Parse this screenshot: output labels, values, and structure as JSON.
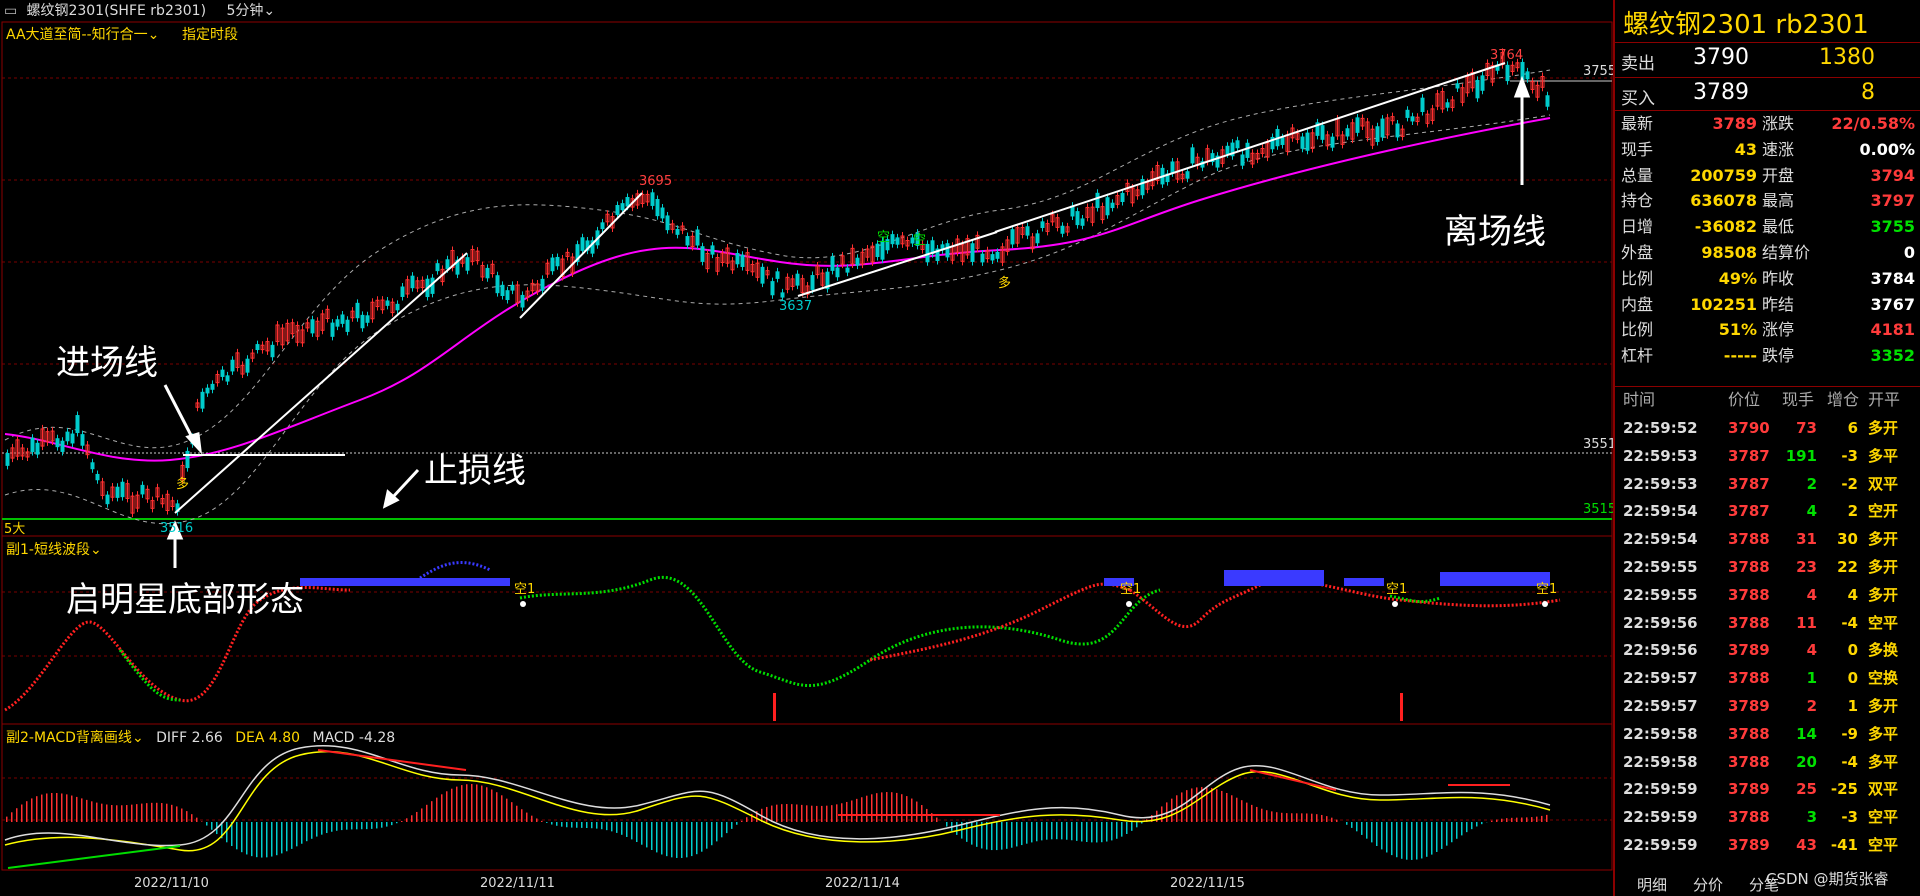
{
  "titlebar": {
    "instrument": "螺纹钢2301(SHFE rb2301)",
    "period": "5分钟"
  },
  "main": {
    "indicator_label": "AA大道至简--知行合一",
    "indicator_option": "指定时段",
    "price_tags": {
      "top": "3755",
      "mid": "3551",
      "bottom": "3515"
    },
    "peak_labels": {
      "p1": "3695",
      "p2": "3764",
      "t1": "3637",
      "t2": "3516"
    },
    "volume_tag": "5大",
    "signals": {
      "kong": "空",
      "duo": "多"
    }
  },
  "annotations": {
    "entry": "进场线",
    "stop": "止损线",
    "exit": "离场线",
    "pattern": "启明星底部形态"
  },
  "sub1": {
    "label": "副1-短线波段",
    "tag": "空1"
  },
  "sub2": {
    "label": "副2-MACD背离画线",
    "diff": "DIFF 2.66",
    "dea": "DEA 4.80",
    "macd": "MACD -4.28"
  },
  "xaxis": [
    "2022/11/10",
    "2022/11/11",
    "2022/11/14",
    "2022/11/15"
  ],
  "watermark": "CSDN @期货张睿",
  "panel": {
    "symbol": "螺纹钢2301  rb2301",
    "ask": {
      "label": "卖出",
      "price": "3790",
      "vol": "1380"
    },
    "bid": {
      "label": "买入",
      "price": "3789",
      "vol": "8"
    },
    "stats": [
      {
        "k": "最新",
        "v": "3789",
        "c": "red",
        "k2": "涨跌",
        "v2": "22/0.58%",
        "c2": "red"
      },
      {
        "k": "现手",
        "v": "43",
        "c": "yel",
        "k2": "速涨",
        "v2": "0.00%",
        "c2": "wht"
      },
      {
        "k": "总量",
        "v": "200759",
        "c": "yel",
        "k2": "开盘",
        "v2": "3794",
        "c2": "red"
      },
      {
        "k": "持仓",
        "v": "636078",
        "c": "yel",
        "k2": "最高",
        "v2": "3797",
        "c2": "red"
      },
      {
        "k": "日增",
        "v": "-36082",
        "c": "yel",
        "k2": "最低",
        "v2": "3755",
        "c2": "grn"
      },
      {
        "k": "外盘",
        "v": "98508",
        "c": "yel",
        "k2": "结算价",
        "v2": "0",
        "c2": "wht"
      },
      {
        "k": "比例",
        "v": "49%",
        "c": "yel",
        "k2": "昨收",
        "v2": "3784",
        "c2": "wht"
      },
      {
        "k": "内盘",
        "v": "102251",
        "c": "yel",
        "k2": "昨结",
        "v2": "3767",
        "c2": "wht"
      },
      {
        "k": "比例",
        "v": "51%",
        "c": "yel",
        "k2": "涨停",
        "v2": "4181",
        "c2": "red"
      },
      {
        "k": "杠杆",
        "v": "-----",
        "c": "yel",
        "k2": "跌停",
        "v2": "3352",
        "c2": "grn"
      }
    ],
    "table_headers": [
      "时间",
      "价位",
      "现手",
      "增仓",
      "开平"
    ],
    "trades": [
      {
        "t": "22:59:52",
        "p": "3790",
        "pc": "red",
        "n": "73",
        "nc": "red",
        "d": "6",
        "o": "多开"
      },
      {
        "t": "22:59:53",
        "p": "3787",
        "pc": "red",
        "n": "191",
        "nc": "grn",
        "d": "-3",
        "o": "多平"
      },
      {
        "t": "22:59:53",
        "p": "3787",
        "pc": "red",
        "n": "2",
        "nc": "grn",
        "d": "-2",
        "o": "双平"
      },
      {
        "t": "22:59:54",
        "p": "3787",
        "pc": "red",
        "n": "4",
        "nc": "grn",
        "d": "2",
        "o": "空开"
      },
      {
        "t": "22:59:54",
        "p": "3788",
        "pc": "red",
        "n": "31",
        "nc": "red",
        "d": "30",
        "o": "多开"
      },
      {
        "t": "22:59:55",
        "p": "3788",
        "pc": "red",
        "n": "23",
        "nc": "red",
        "d": "22",
        "o": "多开"
      },
      {
        "t": "22:59:55",
        "p": "3788",
        "pc": "red",
        "n": "4",
        "nc": "red",
        "d": "4",
        "o": "多开"
      },
      {
        "t": "22:59:56",
        "p": "3788",
        "pc": "red",
        "n": "11",
        "nc": "red",
        "d": "-4",
        "o": "空平"
      },
      {
        "t": "22:59:56",
        "p": "3789",
        "pc": "red",
        "n": "4",
        "nc": "red",
        "d": "0",
        "o": "多换"
      },
      {
        "t": "22:59:57",
        "p": "3788",
        "pc": "red",
        "n": "1",
        "nc": "grn",
        "d": "0",
        "o": "空换"
      },
      {
        "t": "22:59:57",
        "p": "3789",
        "pc": "red",
        "n": "2",
        "nc": "red",
        "d": "1",
        "o": "多开"
      },
      {
        "t": "22:59:58",
        "p": "3788",
        "pc": "red",
        "n": "14",
        "nc": "grn",
        "d": "-9",
        "o": "多平"
      },
      {
        "t": "22:59:58",
        "p": "3788",
        "pc": "red",
        "n": "20",
        "nc": "grn",
        "d": "-4",
        "o": "多平"
      },
      {
        "t": "22:59:59",
        "p": "3789",
        "pc": "red",
        "n": "25",
        "nc": "red",
        "d": "-25",
        "o": "双平"
      },
      {
        "t": "22:59:59",
        "p": "3788",
        "pc": "red",
        "n": "3",
        "nc": "grn",
        "d": "-3",
        "o": "空平"
      },
      {
        "t": "22:59:59",
        "p": "3789",
        "pc": "red",
        "n": "43",
        "nc": "red",
        "d": "-41",
        "o": "空平"
      }
    ],
    "tabs": [
      "明细",
      "分价",
      "分笔"
    ]
  },
  "colors": {
    "ma": "#ff00ff",
    "frame": "#8b0000",
    "stop_line": "#00c000"
  }
}
